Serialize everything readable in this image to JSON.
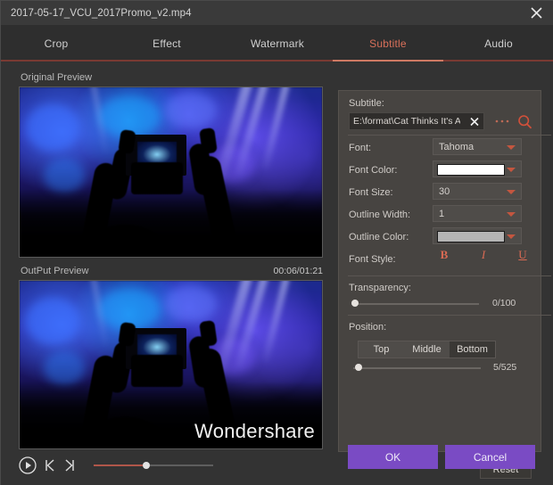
{
  "window": {
    "title": "2017-05-17_VCU_2017Promo_v2.mp4",
    "close_icon": "close-icon"
  },
  "tabs": [
    {
      "label": "Crop",
      "active": false
    },
    {
      "label": "Effect",
      "active": false
    },
    {
      "label": "Watermark",
      "active": false
    },
    {
      "label": "Subtitle",
      "active": true
    },
    {
      "label": "Audio",
      "active": false
    }
  ],
  "preview": {
    "original_label": "Original Preview",
    "output_label": "OutPut Preview",
    "timestamp": "00:06/01:21",
    "watermark_text": "Wondershare",
    "play_icon": "play-icon",
    "prev_frame_icon": "skip-previous-icon",
    "next_frame_icon": "skip-next-icon",
    "seek_value": "41"
  },
  "panel": {
    "subtitle_label": "Subtitle:",
    "subtitle_path": "E:\\format\\Cat Thinks It's A Dog",
    "clear_icon": "close-icon",
    "browse_icon": "ellipsis-icon",
    "browse_label": "...",
    "search_icon": "search-icon",
    "fields": [
      {
        "label": "Font:",
        "value": "Tahoma",
        "type": "select"
      },
      {
        "label": "Font Color:",
        "value": "",
        "type": "color",
        "color": "#ffffff"
      },
      {
        "label": "Font Size:",
        "value": "30",
        "type": "select"
      },
      {
        "label": "Outline Width:",
        "value": "1",
        "type": "select"
      },
      {
        "label": "Outline Color:",
        "value": "",
        "type": "color",
        "color": "#b4b4b4"
      }
    ],
    "font_style_label": "Font Style:",
    "style_bold": "B",
    "style_italic": "I",
    "style_underline": "U",
    "transparency_label": "Transparency:",
    "transparency_value": "0/100",
    "transparency_pct": "0",
    "position_label": "Position:",
    "position_options": [
      {
        "label": "Top",
        "active": false
      },
      {
        "label": "Middle",
        "active": false
      },
      {
        "label": "Bottom",
        "active": true
      }
    ],
    "position_value": "5/525",
    "position_pct": "1",
    "reset_label": "Reset"
  },
  "footer": {
    "ok_label": "OK",
    "cancel_label": "Cancel"
  },
  "colors": {
    "accent_red": "#d9705a",
    "purple": "#7a4bc4",
    "panel_bg": "#474441",
    "window_bg": "#333333"
  }
}
